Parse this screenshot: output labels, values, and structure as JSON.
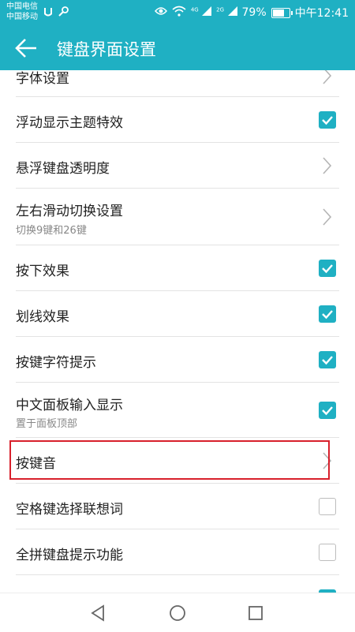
{
  "status_bar": {
    "carrier1": "中国电信",
    "carrier2": "中国移动",
    "net1": "4G",
    "net2": "2G",
    "battery_percent": "79%",
    "battery_level": 0.79,
    "time": "中午12:41"
  },
  "title_bar": {
    "title": "键盘界面设置"
  },
  "settings": {
    "partial_top": "字体设置",
    "floating_theme": "浮动显示主题特效",
    "hover_transparency": "悬浮键盘透明度",
    "swipe_switch": "左右滑动切换设置",
    "swipe_switch_sub": "切换9键和26键",
    "press_effect": "按下效果",
    "stroke_effect": "划线效果",
    "key_char_hint": "按键字符提示",
    "chinese_panel": "中文面板输入显示",
    "chinese_panel_sub": "置于面板顶部",
    "key_sound": "按键音",
    "space_assoc": "空格键选择联想词",
    "full_pinyin_hint": "全拼键盘提示功能"
  },
  "colors": {
    "accent": "#1fb0c3",
    "highlight_border": "#d8202c"
  }
}
